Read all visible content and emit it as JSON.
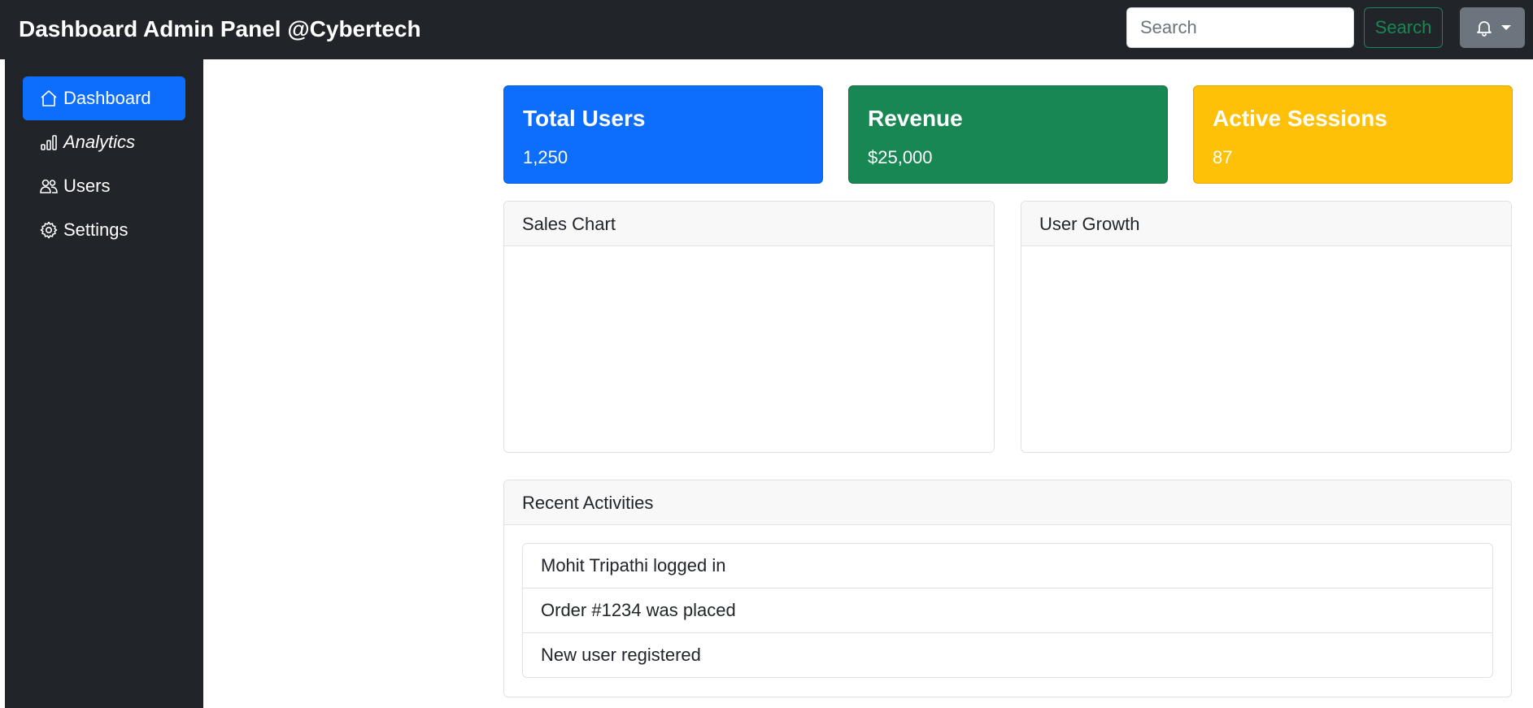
{
  "header": {
    "brand": "Dashboard Admin Panel @Cybertech",
    "search_placeholder": "Search",
    "search_button": "Search",
    "notifications_icon": "bell-icon"
  },
  "sidebar": {
    "items": [
      {
        "label": "Dashboard",
        "icon": "home-icon",
        "active": true
      },
      {
        "label": "Analytics",
        "icon": "bar-chart-icon",
        "active": false
      },
      {
        "label": "Users",
        "icon": "users-icon",
        "active": false
      },
      {
        "label": "Settings",
        "icon": "gear-icon",
        "active": false
      }
    ]
  },
  "stats": [
    {
      "title": "Total Users",
      "value": "1,250",
      "color": "#0d6efd"
    },
    {
      "title": "Revenue",
      "value": "$25,000",
      "color": "#198754"
    },
    {
      "title": "Active Sessions",
      "value": "87",
      "color": "#ffc107"
    }
  ],
  "panels": {
    "sales_chart": "Sales Chart",
    "user_growth": "User Growth",
    "recent_activities": "Recent Activities"
  },
  "activities": [
    "Mohit Tripathi logged in",
    "Order #1234 was placed",
    "New user registered"
  ],
  "colors": {
    "navbar": "#212529",
    "primary": "#0d6efd",
    "success": "#198754",
    "warning": "#ffc107",
    "secondary": "#6c757d"
  }
}
